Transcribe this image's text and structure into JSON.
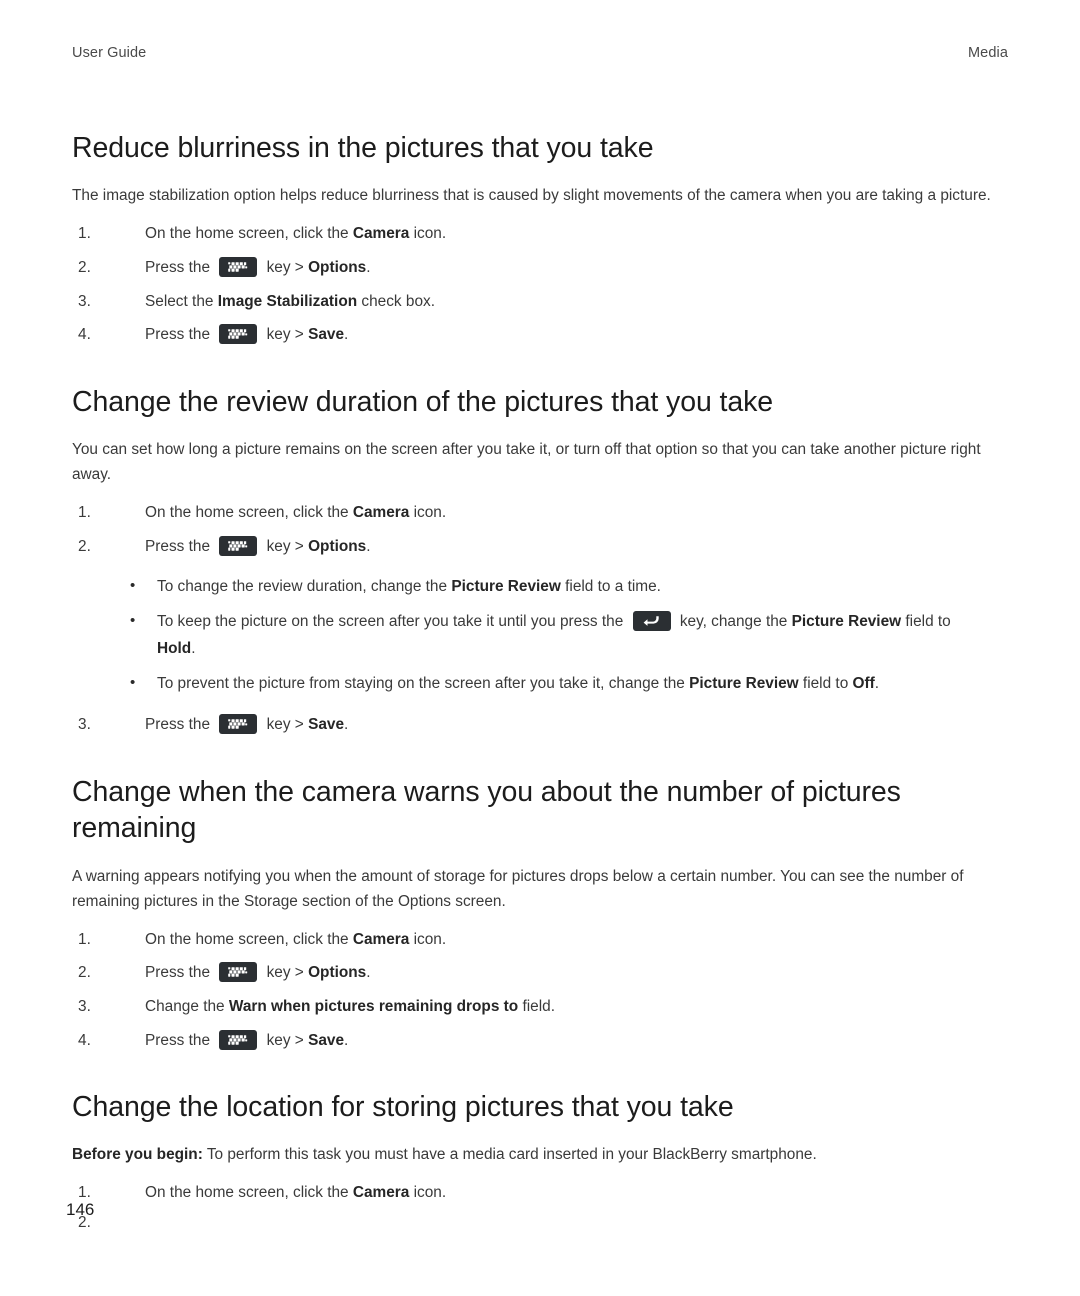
{
  "header": {
    "left": "User Guide",
    "right": "Media"
  },
  "page_number": "146",
  "icons": {
    "menu_key": "blackberry-menu-key-icon",
    "escape_key": "escape-back-key-icon"
  },
  "sections": [
    {
      "title": "Reduce blurriness in the pictures that you take",
      "intro": "The image stabilization option helps reduce blurriness that is caused by slight movements of the camera when you are taking a picture.",
      "steps": [
        {
          "pre": "On the home screen, click the ",
          "bold": "Camera",
          "post": " icon."
        },
        {
          "pre": "Press the ",
          "key": "menu",
          "mid": " key > ",
          "bold": "Options",
          "post": "."
        },
        {
          "pre": "Select the ",
          "bold": "Image Stabilization",
          "post": " check box."
        },
        {
          "pre": "Press the ",
          "key": "menu",
          "mid": " key > ",
          "bold": "Save",
          "post": "."
        }
      ]
    },
    {
      "title": "Change the review duration of the pictures that you take",
      "intro": "You can set how long a picture remains on the screen after you take it, or turn off that option so that you can take another picture right away.",
      "steps_before": [
        {
          "pre": "On the home screen, click the ",
          "bold": "Camera",
          "post": " icon."
        },
        {
          "pre": "Press the ",
          "key": "menu",
          "mid": " key > ",
          "bold": "Options",
          "post": "."
        }
      ],
      "bullets": [
        {
          "pre": "To change the review duration, change the ",
          "bold": "Picture Review",
          "post": " field to a time."
        },
        {
          "pre": "To keep the picture on the screen after you take it until you press the ",
          "key": "escape",
          "mid": " key, change the ",
          "bold": "Picture Review",
          "post": " field to ",
          "bold2": "Hold",
          "post2": "."
        },
        {
          "pre": "To prevent the picture from staying on the screen after you take it, change the ",
          "bold": "Picture Review",
          "post": " field to ",
          "bold2": "Off",
          "post2": "."
        }
      ],
      "steps_after": [
        {
          "number": "3.",
          "pre": "Press the ",
          "key": "menu",
          "mid": " key > ",
          "bold": "Save",
          "post": "."
        }
      ]
    },
    {
      "title": "Change when the camera warns you about the number of pictures remaining",
      "intro": "A warning appears notifying you when the amount of storage for pictures drops below a certain number. You can see the number of remaining pictures in the Storage section of the Options screen.",
      "steps": [
        {
          "pre": "On the home screen, click the ",
          "bold": "Camera",
          "post": " icon."
        },
        {
          "pre": "Press the ",
          "key": "menu",
          "mid": " key > ",
          "bold": "Options",
          "post": "."
        },
        {
          "pre": "Change the ",
          "bold": "Warn when pictures remaining drops to",
          "post": " field."
        },
        {
          "pre": "Press the ",
          "key": "menu",
          "mid": " key > ",
          "bold": "Save",
          "post": "."
        }
      ]
    },
    {
      "title": "Change the location for storing pictures that you take",
      "note_bold": "Before you begin:",
      "note_text": " To perform this task you must have a media card inserted in your BlackBerry smartphone.",
      "steps": [
        {
          "pre": "On the home screen, click the ",
          "bold": "Camera",
          "post": " icon."
        },
        {
          "pre": "",
          "bold": "",
          "post": ""
        }
      ]
    }
  ]
}
